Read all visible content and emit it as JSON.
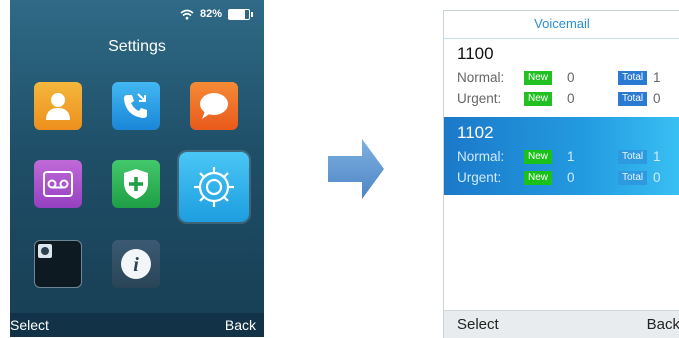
{
  "left_phone": {
    "status": {
      "battery_percent": "82%",
      "wifi_icon": "wifi-icon",
      "battery_icon": "battery-icon",
      "battery_level": 0.82
    },
    "title": "Settings",
    "apps": [
      {
        "name": "contacts",
        "icon": "contacts-icon"
      },
      {
        "name": "calls",
        "icon": "phone-call-icon"
      },
      {
        "name": "messages",
        "icon": "chat-bubble-icon"
      },
      {
        "name": "voicemail",
        "icon": "voicemail-icon"
      },
      {
        "name": "security",
        "icon": "shield-plus-icon"
      },
      {
        "name": "settings",
        "icon": "gear-icon",
        "selected": true
      },
      {
        "name": "camera",
        "icon": "camera-app-icon"
      },
      {
        "name": "info",
        "icon": "info-icon"
      }
    ],
    "softkeys": {
      "left": "Select",
      "right": "Back"
    }
  },
  "arrow_icon": "right-arrow-icon",
  "right_phone": {
    "title": "Voicemail",
    "accounts": [
      {
        "number": "1100",
        "normal": {
          "label": "Normal:",
          "new_badge": "New",
          "new_count": "0",
          "total_badge": "Total",
          "total_count": "1"
        },
        "urgent": {
          "label": "Urgent:",
          "new_badge": "New",
          "new_count": "0",
          "total_badge": "Total",
          "total_count": "0"
        },
        "selected": false
      },
      {
        "number": "1102",
        "normal": {
          "label": "Normal:",
          "new_badge": "New",
          "new_count": "1",
          "total_badge": "Total",
          "total_count": "1"
        },
        "urgent": {
          "label": "Urgent:",
          "new_badge": "New",
          "new_count": "0",
          "total_badge": "Total",
          "total_count": "0"
        },
        "selected": true
      }
    ],
    "softkeys": {
      "left": "Select",
      "right": "Back"
    }
  },
  "colors": {
    "accent": "#2a8fd0",
    "new_badge": "#22c022",
    "total_badge": "#2a7ad2",
    "selection": "#239be1"
  }
}
